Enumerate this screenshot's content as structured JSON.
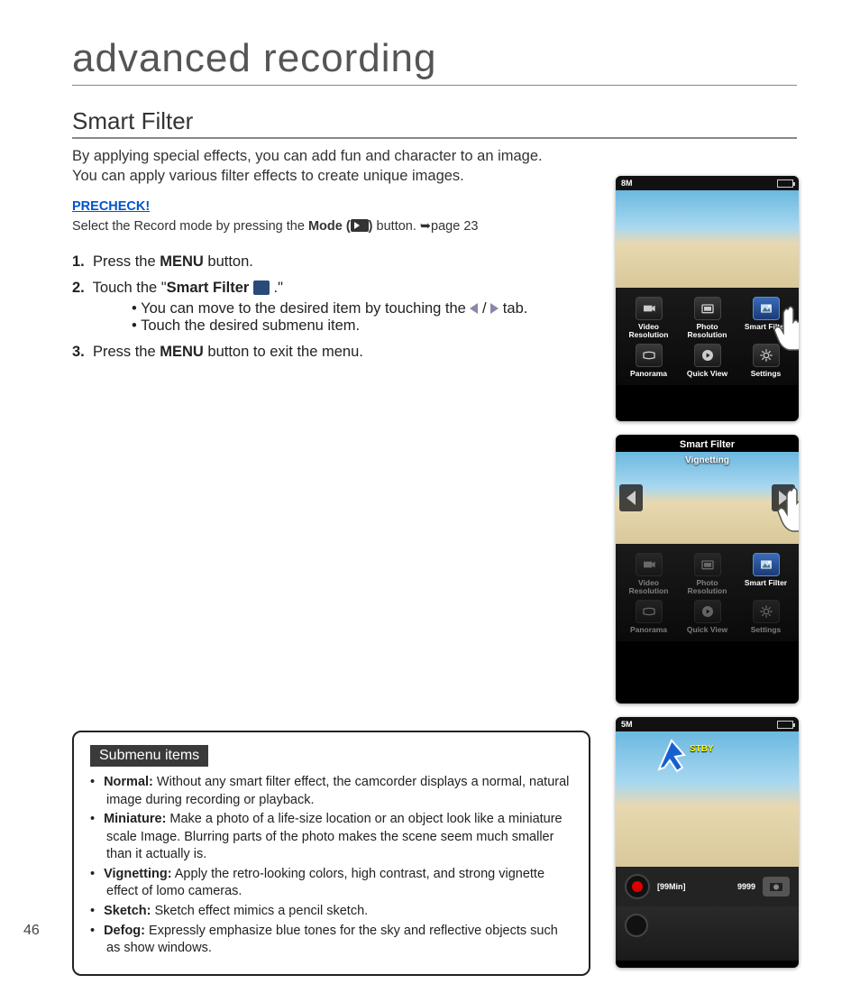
{
  "page_number": "46",
  "chapter_title": "advanced recording",
  "section_title": "Smart Filter",
  "intro_line1": "By applying special effects, you can add fun and character to an image.",
  "intro_line2": "You can apply various filter effects to create unique images.",
  "precheck_label": "PRECHECK!",
  "precheck_text_a": "Select the Record mode by pressing the ",
  "precheck_mode_word": "Mode (",
  "precheck_text_b": ") ",
  "precheck_text_c": "button. ➥page 23",
  "steps": {
    "s1_num": "1.",
    "s1_a": "Press the ",
    "s1_b": "MENU",
    "s1_c": " button.",
    "s2_num": "2.",
    "s2_a": "Touch the \"",
    "s2_b": "Smart Filter",
    "s2_c": " .\"",
    "s2_b1": "You can move to the desired item by touching the ",
    "s2_b1b": " tab.",
    "s2_b2": "Touch the desired submenu item.",
    "s3_num": "3.",
    "s3_a": "Press the ",
    "s3_b": "MENU",
    "s3_c": " button to exit the menu."
  },
  "submenu": {
    "heading": "Submenu items",
    "items": [
      {
        "term": "Normal:",
        "desc": "Without any smart filter effect, the camcorder displays a normal, natural image during recording or playback."
      },
      {
        "term": "Miniature:",
        "desc": "Make a photo of a life-size location or an object look like a miniature scale Image. Blurring parts of the photo makes the scene seem much smaller than it actually is."
      },
      {
        "term": "Vignetting:",
        "desc": "Apply the retro-looking colors, high contrast, and strong vignette effect of lomo cameras."
      },
      {
        "term": "Sketch:",
        "desc": "Sketch effect mimics a pencil sketch."
      },
      {
        "term": "Defog:",
        "desc": "Expressly emphasize blue tones for the sky and reflective objects such as show windows."
      }
    ]
  },
  "device1": {
    "status_res": "8M",
    "menu": [
      "Video Resolution",
      "Photo Resolution",
      "Smart Filter",
      "Panorama",
      "Quick View",
      "Settings"
    ]
  },
  "device2": {
    "title": "Smart Filter",
    "current_filter": "Vignetting",
    "menu": [
      "Video Resolution",
      "Photo Resolution",
      "Smart Filter",
      "Panorama",
      "Quick View",
      "Settings"
    ]
  },
  "device3": {
    "status_res": "5M",
    "stby": "STBY",
    "time_remaining": "[99Min]",
    "shots_remaining": "9999"
  }
}
